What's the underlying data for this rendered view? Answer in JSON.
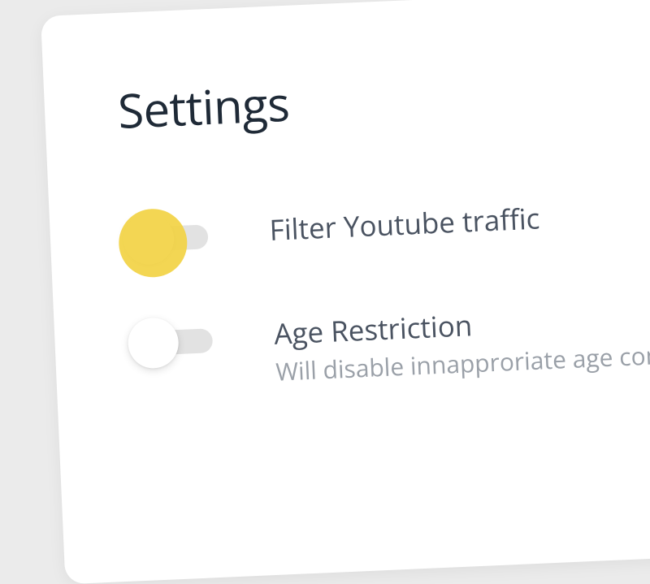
{
  "page": {
    "title": "Settings"
  },
  "settings": [
    {
      "label": "Filter Youtube traffic",
      "description": "",
      "toggled": false,
      "highlighted": true
    },
    {
      "label": "Age Restriction",
      "description": "Will disable innapproriate age content",
      "toggled": false,
      "highlighted": false
    }
  ],
  "colors": {
    "highlight": "#f2d244",
    "text_primary": "#1f2a37",
    "text_secondary": "#4a5361",
    "text_muted": "#9aa0a8",
    "track": "#e2e2e2"
  }
}
